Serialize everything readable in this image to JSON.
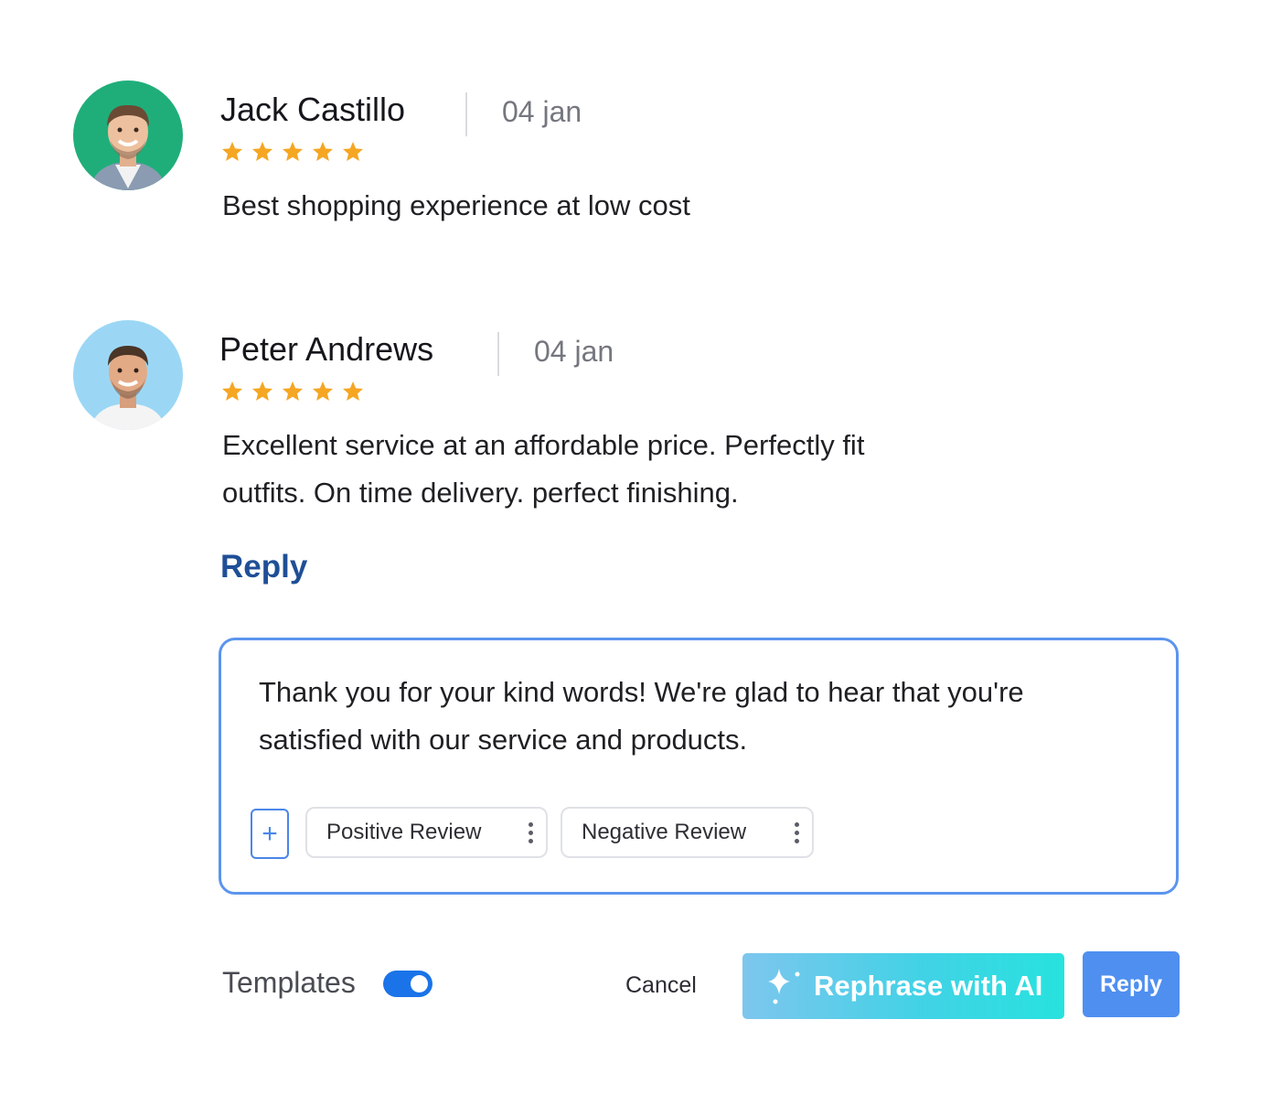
{
  "reviews": [
    {
      "name": "Jack Castillo",
      "date": "04 jan",
      "rating": 5,
      "text": "Best shopping experience at low cost",
      "avatar_bg": "#1fae7a"
    },
    {
      "name": "Peter Andrews",
      "date": "04 jan",
      "rating": 5,
      "text_lines": [
        "Excellent service at an affordable price. Perfectly fit",
        "outfits. On time delivery. perfect finishing."
      ],
      "avatar_bg": "#9bd7f5"
    }
  ],
  "reply_link": "Reply",
  "reply_box": {
    "lines": [
      "Thank you for your kind words! We're glad to hear that you're",
      "satisfied with our service and products."
    ],
    "add_label": "+",
    "chips": [
      "Positive Review",
      "Negative Review"
    ]
  },
  "footer": {
    "templates_label": "Templates",
    "templates_enabled": true,
    "cancel_label": "Cancel",
    "rephrase_label": "Rephrase with AI",
    "reply_label": "Reply"
  },
  "colors": {
    "star": "#f5a623",
    "accent": "#4f8ff0",
    "reply_link": "#1f4f96",
    "toggle": "#1a73e8"
  },
  "icons": [
    "star-icon",
    "plus-icon",
    "kebab-menu-icon",
    "sparkle-icon"
  ]
}
